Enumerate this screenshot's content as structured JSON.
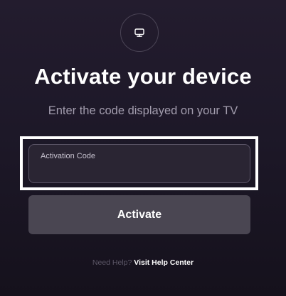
{
  "icon": {
    "name": "monitor-icon"
  },
  "header": {
    "title": "Activate your device",
    "subtitle": "Enter the code displayed on your TV"
  },
  "form": {
    "activation_code_label": "Activation Code",
    "activation_code_value": "",
    "activate_label": "Activate"
  },
  "help": {
    "prefix": "Need Help?",
    "link": "Visit Help Center"
  },
  "colors": {
    "background": "#1d1828",
    "button": "#4a4652",
    "focus_ring": "#ffffff"
  }
}
